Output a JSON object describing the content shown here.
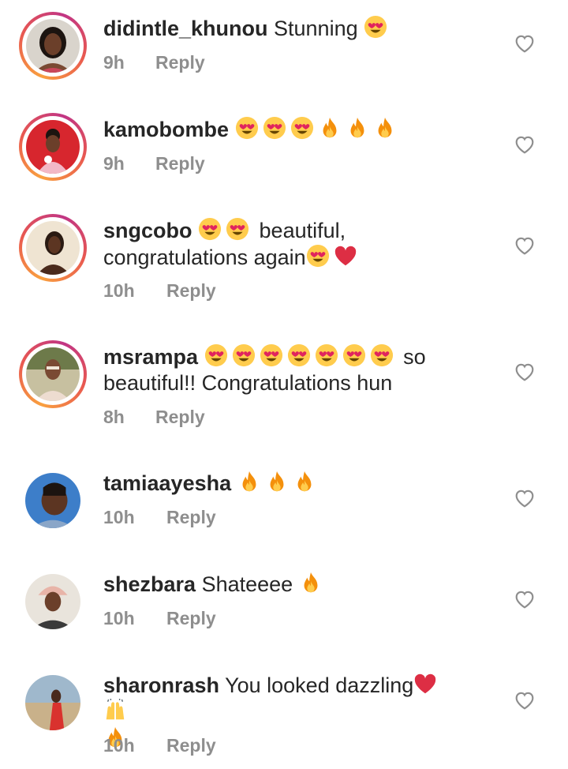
{
  "reply_label": "Reply",
  "colors": {
    "text": "#262626",
    "meta": "#8e8e8e",
    "heart_outline": "#8e8e8e",
    "ring_start": "#f9a03f",
    "ring_end": "#c13584"
  },
  "icons": {
    "like": "heart-outline-icon",
    "heart_eyes": "heart-eyes-emoji",
    "fire": "fire-emoji",
    "red_heart": "red-heart-emoji",
    "raising_hands": "raising-hands-emoji"
  },
  "comments": [
    {
      "username": "didintle_khunou",
      "text_parts": [
        "Stunning"
      ],
      "time": "9h",
      "has_story": true
    },
    {
      "username": "kamobombe",
      "text_parts": [],
      "time": "9h",
      "has_story": true
    },
    {
      "username": "sngcobo",
      "text_parts": [
        "beautiful,",
        "congratulations again"
      ],
      "time": "10h",
      "has_story": true
    },
    {
      "username": "msrampa",
      "text_parts": [
        "so",
        "beautiful!! Congratulations hun"
      ],
      "time": "8h",
      "has_story": true
    },
    {
      "username": "tamiaayesha",
      "text_parts": [],
      "time": "10h",
      "has_story": false
    },
    {
      "username": "shezbara",
      "text_parts": [
        "Shateeee"
      ],
      "time": "10h",
      "has_story": false
    },
    {
      "username": "sharonrash",
      "text_parts": [
        "You looked dazzling"
      ],
      "time": "10h",
      "has_story": false
    }
  ]
}
